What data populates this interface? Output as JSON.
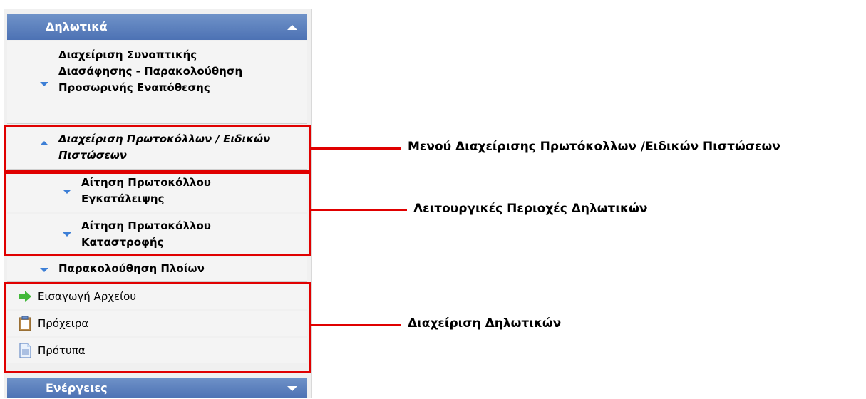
{
  "sidebar": {
    "declarations_header": "Δηλωτικά",
    "items": [
      {
        "label": "Διαχείριση Συνοπτικής Διασάφησης - Παρακολούθηση Προσωρινής Εναπόθεσης"
      },
      {
        "label": "Διαχείριση Πρωτοκόλλων / Ειδικών Πιστώσεων"
      },
      {
        "label": "Αίτηση Πρωτοκόλλου Εγκατάλειψης"
      },
      {
        "label": "Αίτηση Πρωτοκόλλου Καταστροφής"
      },
      {
        "label": "Παρακολούθηση Πλοίων"
      }
    ],
    "tools": [
      {
        "label": "Εισαγωγή Αρχείου",
        "icon": "green-arrow-icon"
      },
      {
        "label": "Πρόχειρα",
        "icon": "clipboard-icon"
      },
      {
        "label": "Πρότυπα",
        "icon": "document-icon"
      }
    ],
    "actions_header": "Ενέργειες"
  },
  "callouts": {
    "protocols_menu": "Μενού Διαχείρισης Πρωτόκολλων /Ειδικών Πιστώσεων",
    "functional_areas": "Λειτουργικές Περιοχές Δηλωτικών",
    "declarations_management": "Διαχείριση Δηλωτικών"
  },
  "colors": {
    "header_blue": "#4d72b4",
    "caret_blue": "#3d7fd6",
    "annotation_red": "#e00000"
  }
}
